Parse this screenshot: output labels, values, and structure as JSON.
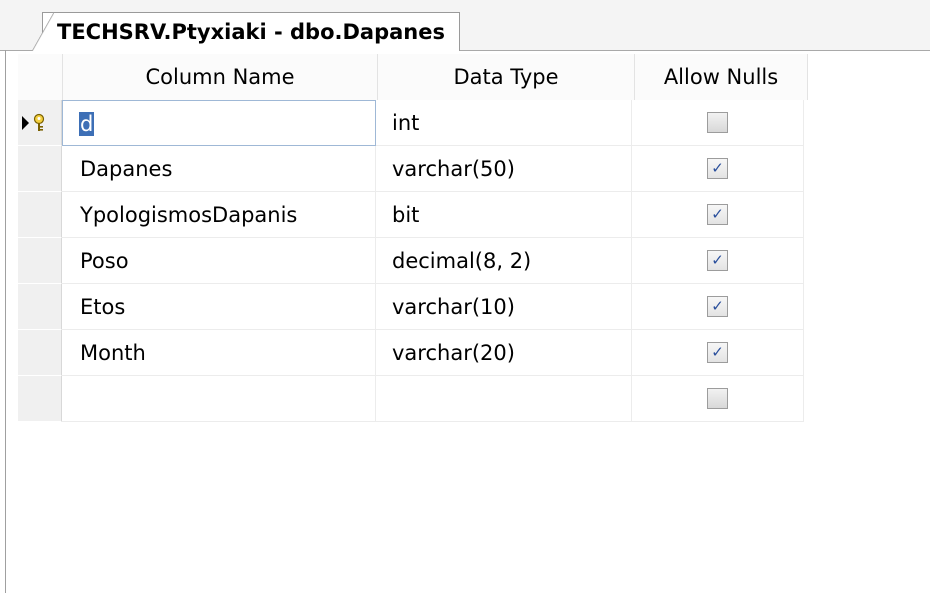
{
  "tab": {
    "title": "TECHSRV.Ptyxiaki - dbo.Dapanes"
  },
  "grid": {
    "headers": {
      "column_name": "Column Name",
      "data_type": "Data Type",
      "allow_nulls": "Allow Nulls"
    },
    "rows": [
      {
        "name": "d",
        "type": "int",
        "allow_nulls": false,
        "primary_key": true,
        "selected": true
      },
      {
        "name": "Dapanes",
        "type": "varchar(50)",
        "allow_nulls": true
      },
      {
        "name": "YpologismosDapanis",
        "type": "bit",
        "allow_nulls": true
      },
      {
        "name": "Poso",
        "type": "decimal(8, 2)",
        "allow_nulls": true
      },
      {
        "name": "Etos",
        "type": "varchar(10)",
        "allow_nulls": true
      },
      {
        "name": "Month",
        "type": "varchar(20)",
        "allow_nulls": true
      },
      {
        "name": "",
        "type": "",
        "allow_nulls": false
      }
    ]
  },
  "icons": {
    "row_indicator": "current-row-arrow-icon",
    "primary_key": "primary-key-icon",
    "checkbox": "checkbox-icon"
  }
}
